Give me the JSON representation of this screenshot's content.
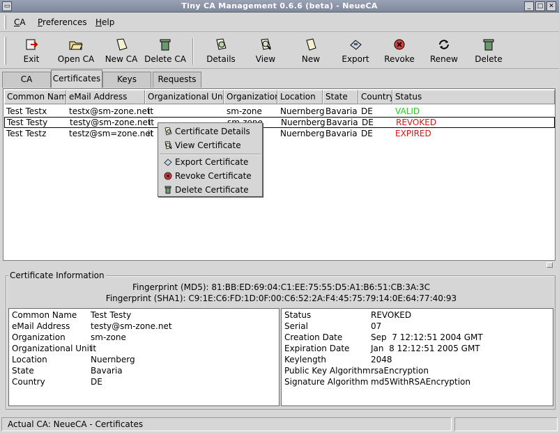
{
  "window": {
    "title": "Tiny CA Management 0.6.6 (beta) - NeueCA"
  },
  "menu": {
    "items": [
      "CA",
      "Preferences",
      "Help"
    ]
  },
  "toolbar": {
    "exit": "Exit",
    "open_ca": "Open CA",
    "new_ca": "New CA",
    "delete_ca": "Delete CA",
    "details": "Details",
    "view": "View",
    "new": "New",
    "export": "Export",
    "revoke": "Revoke",
    "renew": "Renew",
    "delete": "Delete"
  },
  "tabs": [
    "CA",
    "Certificates",
    "Keys",
    "Requests"
  ],
  "list": {
    "columns": [
      "Common Name",
      "eMail Address",
      "Organizational Unit",
      "Organization",
      "Location",
      "State",
      "Country",
      "Status"
    ],
    "rows": [
      {
        "cn": "Test Testx",
        "email": "testx@sm-zone.net",
        "ou": "it",
        "org": "sm-zone",
        "loc": "Nuernberg",
        "state": "Bavaria",
        "country": "DE",
        "status": "VALID"
      },
      {
        "cn": "Test Testy",
        "email": "testy@sm-zone.net",
        "ou": "it",
        "org": "sm-zone",
        "loc": "Nuernberg",
        "state": "Bavaria",
        "country": "DE",
        "status": "REVOKED"
      },
      {
        "cn": "Test Testz",
        "email": "testz@sm=zone.net",
        "ou": "it",
        "org": "",
        "loc": "Nuernberg",
        "state": "Bavaria",
        "country": "DE",
        "status": "EXPIRED"
      }
    ],
    "status_colors": {
      "VALID": "#22cc22",
      "REVOKED": "#dd1111",
      "EXPIRED": "#dd1111"
    }
  },
  "context_menu": {
    "items": [
      "Certificate Details",
      "View Certificate",
      "Export Certificate",
      "Revoke Certificate",
      "Delete Certificate"
    ]
  },
  "info": {
    "legend": "Certificate Information",
    "fingerprint_md5": "Fingerprint (MD5): 81:BB:ED:69:04:C1:EE:75:55:D5:A1:B6:51:CB:3A:3C",
    "fingerprint_sha1": "Fingerprint (SHA1): C9:1E:C6:FD:1D:0F:00:C6:52:2A:F4:45:75:79:14:0E:64:77:40:93",
    "subject": [
      {
        "k": "Common Name",
        "v": "Test Testy"
      },
      {
        "k": "eMail Address",
        "v": "testy@sm-zone.net"
      },
      {
        "k": "Organization",
        "v": "sm-zone"
      },
      {
        "k": "Organizational Unit",
        "v": "it"
      },
      {
        "k": "Location",
        "v": "Nuernberg"
      },
      {
        "k": "State",
        "v": "Bavaria"
      },
      {
        "k": "Country",
        "v": "DE"
      }
    ],
    "cert": [
      {
        "k": "Status",
        "v": "REVOKED"
      },
      {
        "k": "Serial",
        "v": "07"
      },
      {
        "k": "Creation Date",
        "v": "Sep  7 12:12:51 2004 GMT"
      },
      {
        "k": "Expiration Date",
        "v": "Jan  8 12:12:51 2005 GMT"
      },
      {
        "k": "Keylength",
        "v": "2048"
      },
      {
        "k": "Public Key Algorithm",
        "v": "rsaEncryption"
      },
      {
        "k": "Signature Algorithm",
        "v": "md5WithRSAEncryption"
      }
    ]
  },
  "statusbar": {
    "text": "Actual CA: NeueCA - Certificates"
  }
}
